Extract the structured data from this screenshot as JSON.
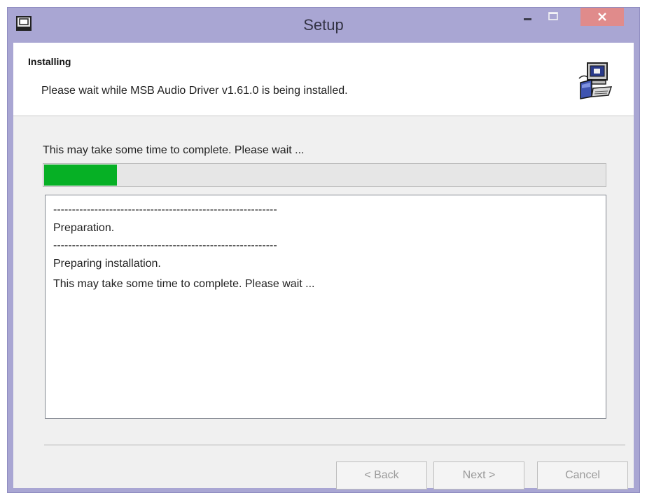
{
  "window": {
    "title": "Setup",
    "titlebar_color": "#a9a6d3",
    "close_color": "#e08b8b"
  },
  "header": {
    "title": "Installing",
    "description": "Please wait while MSB Audio Driver v1.61.0 is being installed.",
    "icon": "installer-computer-icon"
  },
  "status": {
    "text": "This may take some time to complete. Please wait ...",
    "progress_fraction": 0.13,
    "progress_color": "#06b025"
  },
  "log": {
    "lines": [
      "------------------------------------------------------------",
      "Preparation.",
      "------------------------------------------------------------",
      "Preparing installation.",
      "This may take some time to complete. Please wait ..."
    ]
  },
  "buttons": {
    "back": "< Back",
    "next": "Next >",
    "cancel": "Cancel"
  },
  "icons": {
    "app": "setup-app-icon",
    "minimize": "minimize-icon",
    "maximize": "maximize-icon",
    "close": "close-icon"
  }
}
